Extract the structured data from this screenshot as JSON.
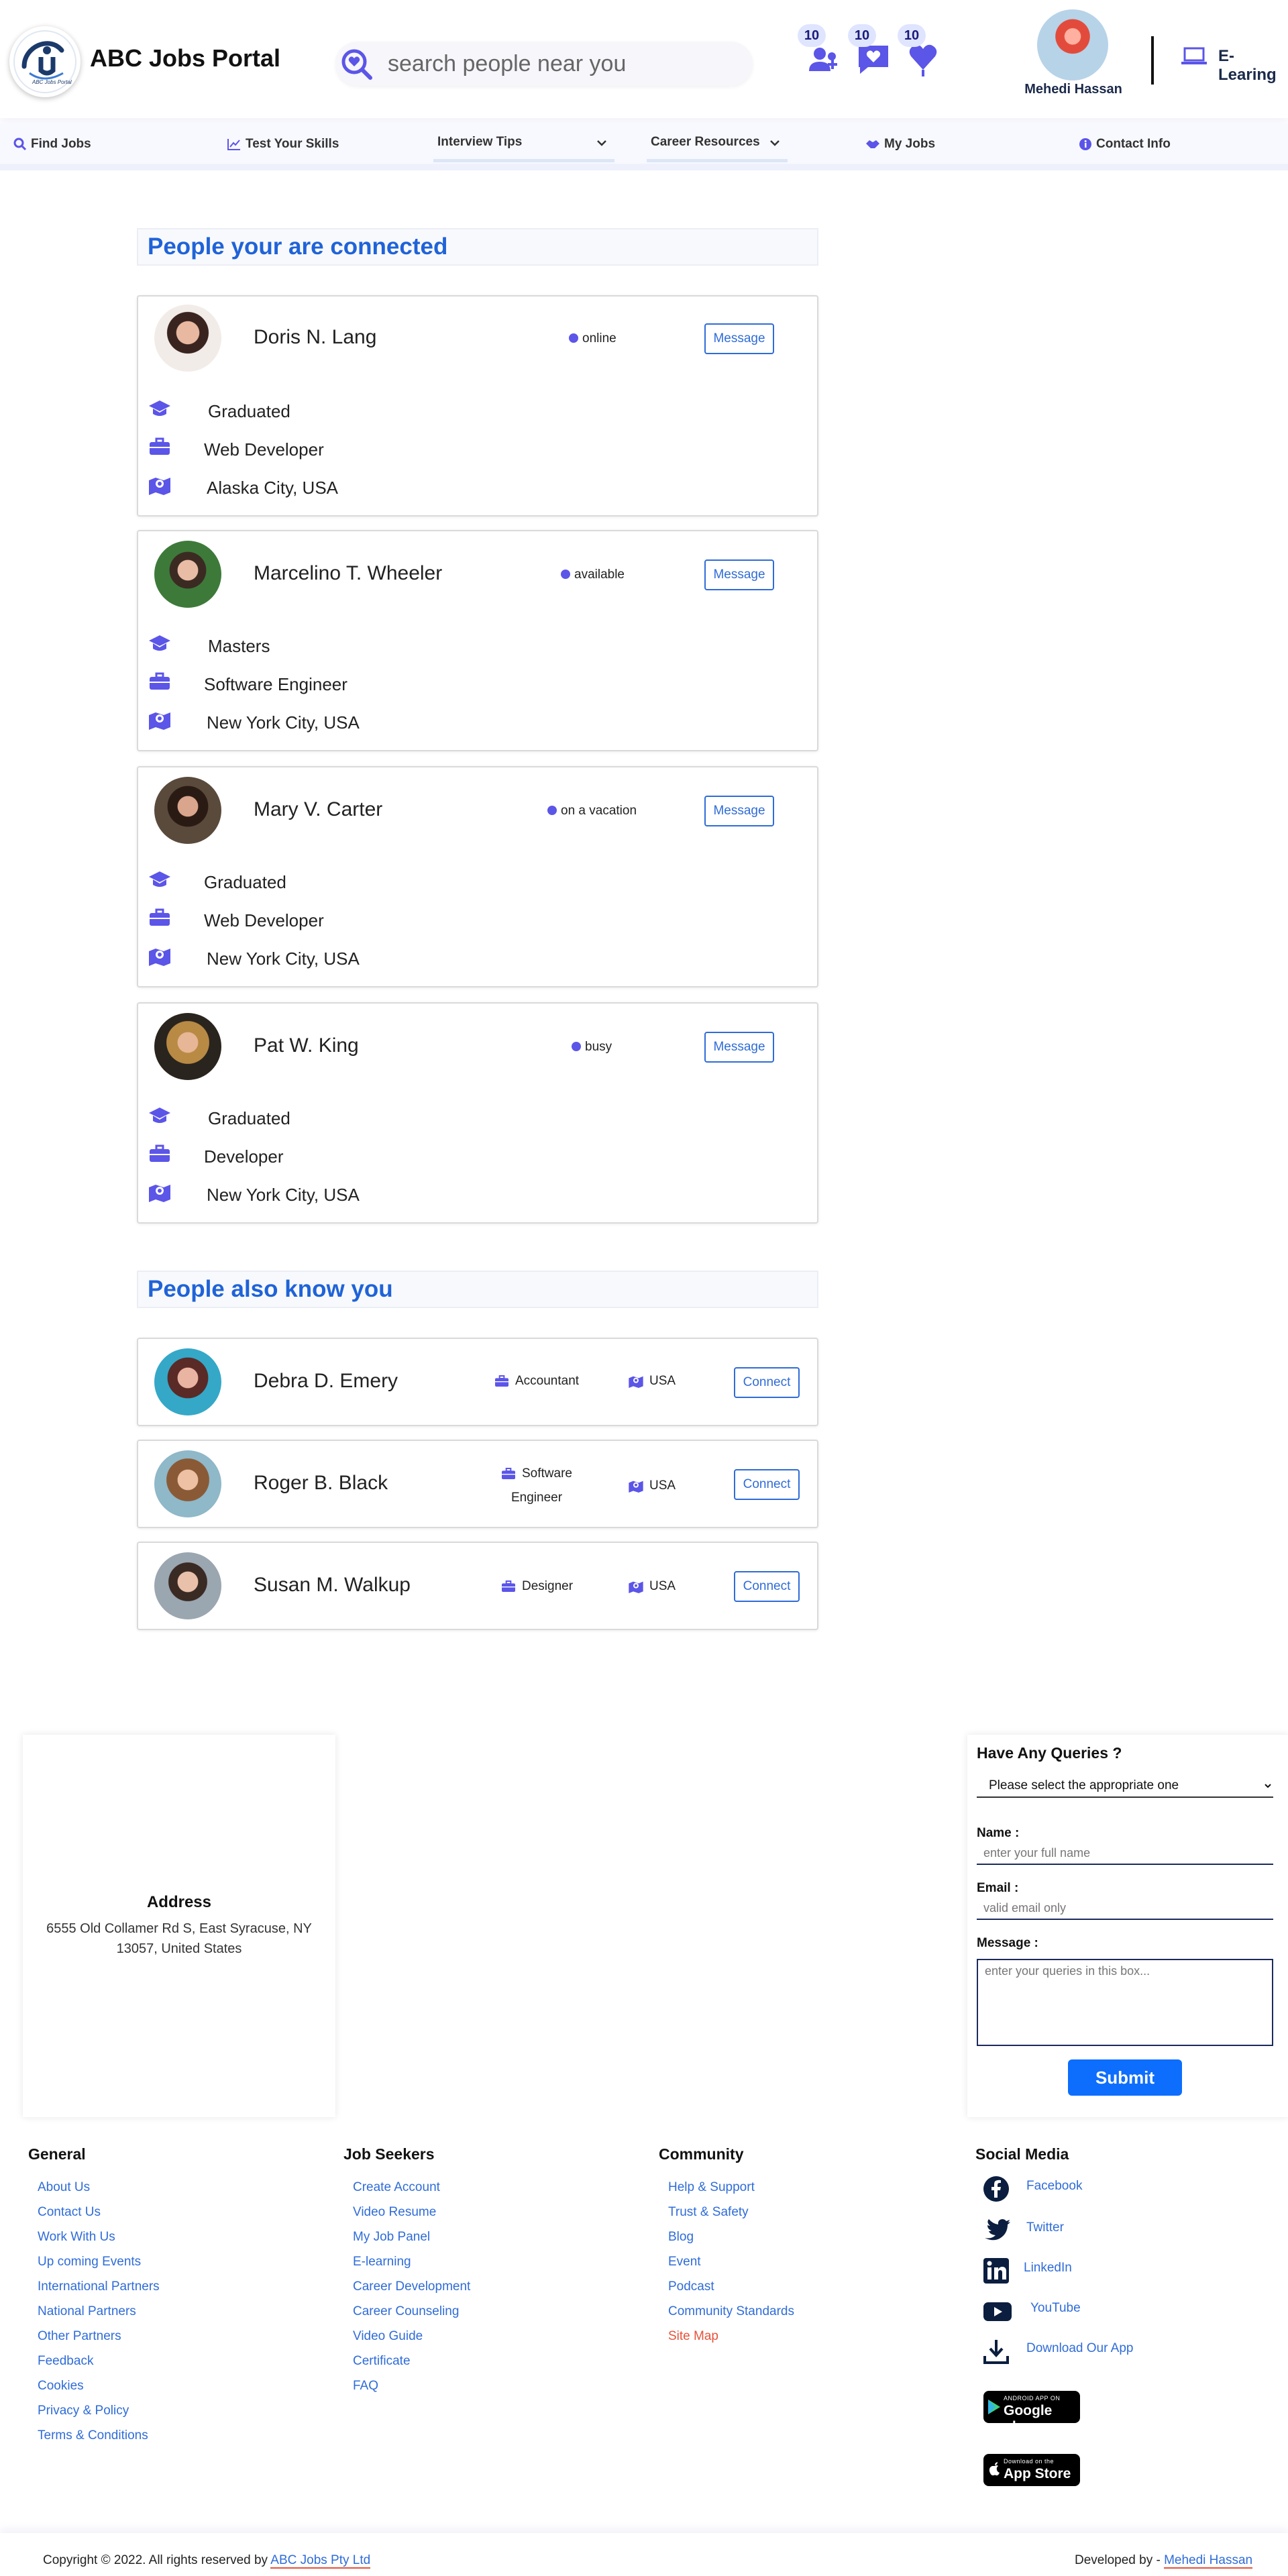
{
  "header": {
    "site_title": "ABC Jobs Portal",
    "logo_text": "ABC Jobs Portal",
    "search_placeholder": "search people near you",
    "badges": {
      "connections": "10",
      "messages": "10",
      "likes": "10"
    },
    "user_name": "Mehedi Hassan",
    "elearning_label": "E-Learing"
  },
  "nav": {
    "find_jobs": "Find Jobs",
    "test_skills": "Test Your Skills",
    "interview_tips": "Interview Tips",
    "career_resources": "Career Resources",
    "my_jobs": "My Jobs",
    "contact_info": "Contact Info"
  },
  "connected": {
    "title": "People your are connected",
    "message_label": "Message",
    "people": [
      {
        "name": "Doris N. Lang",
        "status": "online",
        "education": "Graduated",
        "job": "Web Developer",
        "location": "Alaska City, USA"
      },
      {
        "name": "Marcelino T. Wheeler",
        "status": "available",
        "education": "Masters",
        "job": "Software Engineer",
        "location": "New York City, USA"
      },
      {
        "name": "Mary V. Carter",
        "status": "on a vacation",
        "education": "Graduated",
        "job": "Web Developer",
        "location": "New York City, USA"
      },
      {
        "name": "Pat W. King",
        "status": "busy",
        "education": "Graduated",
        "job": "Developer",
        "location": "New York City, USA"
      }
    ]
  },
  "suggested": {
    "title": "People also know you",
    "connect_label": "Connect",
    "people": [
      {
        "name": "Debra D. Emery",
        "job": "Accountant",
        "job_line2": "",
        "country": "USA"
      },
      {
        "name": "Roger B. Black",
        "job": "Software",
        "job_line2": "Engineer",
        "country": "USA"
      },
      {
        "name": "Susan M. Walkup",
        "job": "Designer",
        "job_line2": "",
        "country": "USA"
      }
    ]
  },
  "address": {
    "title": "Address",
    "text": "6555 Old Collamer Rd S, East Syracuse, NY 13057, United States"
  },
  "query_form": {
    "title": "Have Any Queries ?",
    "select_value": "Please select the appropriate one",
    "name_label": "Name :",
    "name_placeholder": "enter your full name",
    "email_label": "Email :",
    "email_placeholder": "valid email only",
    "message_label": "Message :",
    "message_placeholder": "enter your queries in this box...",
    "submit_label": "Submit"
  },
  "footer": {
    "general": {
      "title": "General",
      "links": [
        "About Us",
        "Contact Us",
        "Work With Us",
        "Up coming Events",
        "International Partners",
        "National Partners",
        "Other Partners",
        "Feedback",
        "Cookies",
        "Privacy & Policy",
        "Terms & Conditions"
      ]
    },
    "job_seekers": {
      "title": "Job Seekers",
      "links": [
        "Create Account",
        "Video Resume",
        "My Job Panel",
        "E-learning",
        "Career Development",
        "Career Counseling",
        "Video Guide",
        "Certificate",
        "FAQ"
      ]
    },
    "community": {
      "title": "Community",
      "links": [
        "Help & Support",
        "Trust & Safety",
        "Blog",
        "Event",
        "Podcast",
        "Community Standards",
        "Site Map"
      ]
    },
    "social": {
      "title": "Social Media",
      "facebook": "Facebook",
      "twitter": "Twitter",
      "linkedin": "LinkedIn",
      "youtube": "YouTube",
      "download": "Download Our App"
    },
    "google_play": {
      "small": "ANDROID APP ON",
      "big": "Google play"
    },
    "app_store": {
      "small": "Download on the",
      "big": "App Store"
    }
  },
  "copyright": {
    "left_prefix": "Copyright © 2022. All rights reserved by",
    "company": "ABC Jobs Pty Ltd",
    "right_prefix": "Developed by -",
    "developer": "Mehedi Hassan"
  },
  "colors": {
    "accent_blue": "#1f63d8",
    "icon_purple": "#5b55e8",
    "submit_blue": "#0d6efd",
    "site_map_red": "#e5533b"
  }
}
